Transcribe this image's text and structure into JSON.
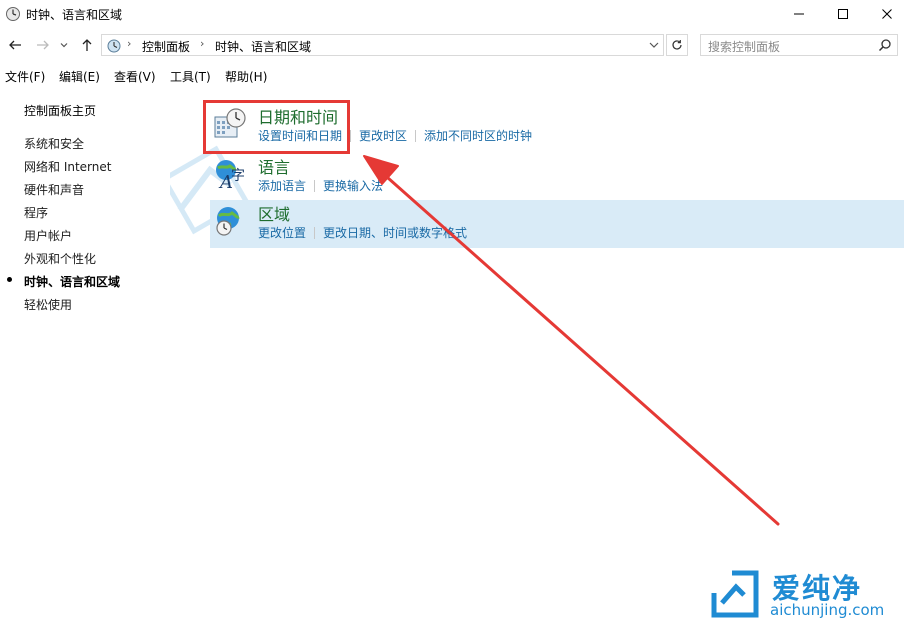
{
  "window": {
    "title": "时钟、语言和区域",
    "colors": {
      "close_hover": "#e81123"
    }
  },
  "address_bar": {
    "breadcrumbs": [
      "控制面板",
      "时钟、语言和区域"
    ]
  },
  "search": {
    "placeholder": "搜索控制面板"
  },
  "menu": [
    {
      "label": "文件(F)"
    },
    {
      "label": "编辑(E)"
    },
    {
      "label": "查看(V)"
    },
    {
      "label": "工具(T)"
    },
    {
      "label": "帮助(H)"
    }
  ],
  "sidebar": {
    "home": "控制面板主页",
    "items": [
      {
        "label": "系统和安全"
      },
      {
        "label": "网络和 Internet"
      },
      {
        "label": "硬件和声音"
      },
      {
        "label": "程序"
      },
      {
        "label": "用户帐户"
      },
      {
        "label": "外观和个性化"
      },
      {
        "label": "时钟、语言和区域"
      },
      {
        "label": "轻松使用"
      }
    ]
  },
  "categories": [
    {
      "title": "日期和时间",
      "icon": "calendar-clock-icon",
      "links": [
        "设置时间和日期",
        "更改时区",
        "添加不同时区的时钟"
      ]
    },
    {
      "title": "语言",
      "icon": "language-icon",
      "links": [
        "添加语言",
        "更换输入法"
      ]
    },
    {
      "title": "区域",
      "icon": "globe-clock-icon",
      "links": [
        "更改位置",
        "更改日期、时间或数字格式"
      ]
    }
  ],
  "annotation": {
    "color": "#e53935"
  },
  "watermark": {
    "brand": "爱纯净",
    "domain": "aichunjing.com",
    "color": "#1f8bd3"
  }
}
